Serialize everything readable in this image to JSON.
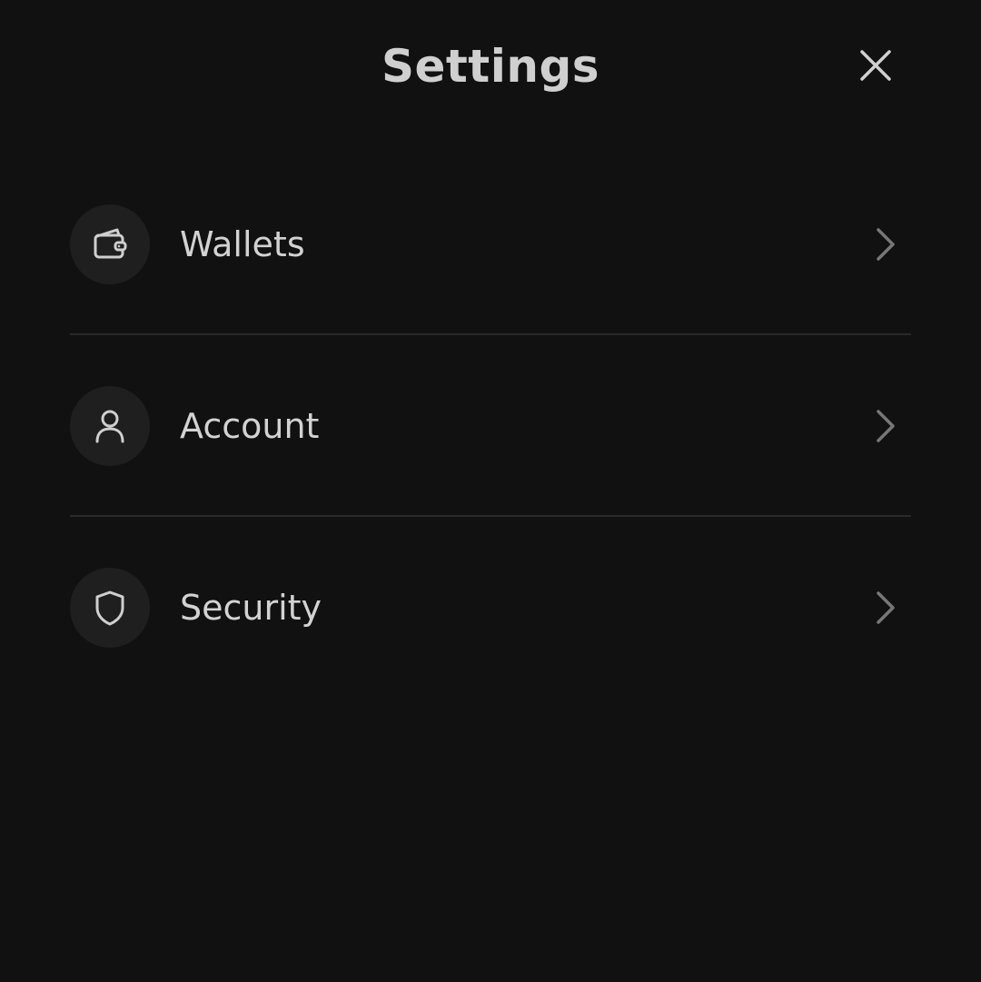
{
  "header": {
    "title": "Settings",
    "close_icon": "close-icon"
  },
  "menu": {
    "items": [
      {
        "label": "Wallets",
        "icon": "wallet-icon"
      },
      {
        "label": "Account",
        "icon": "user-icon"
      },
      {
        "label": "Security",
        "icon": "shield-icon"
      }
    ]
  },
  "colors": {
    "background": "#111111",
    "text": "#d2d2d2",
    "icon_circle": "#1f1f1f",
    "divider": "#2a2a2a",
    "chevron": "#777777"
  }
}
